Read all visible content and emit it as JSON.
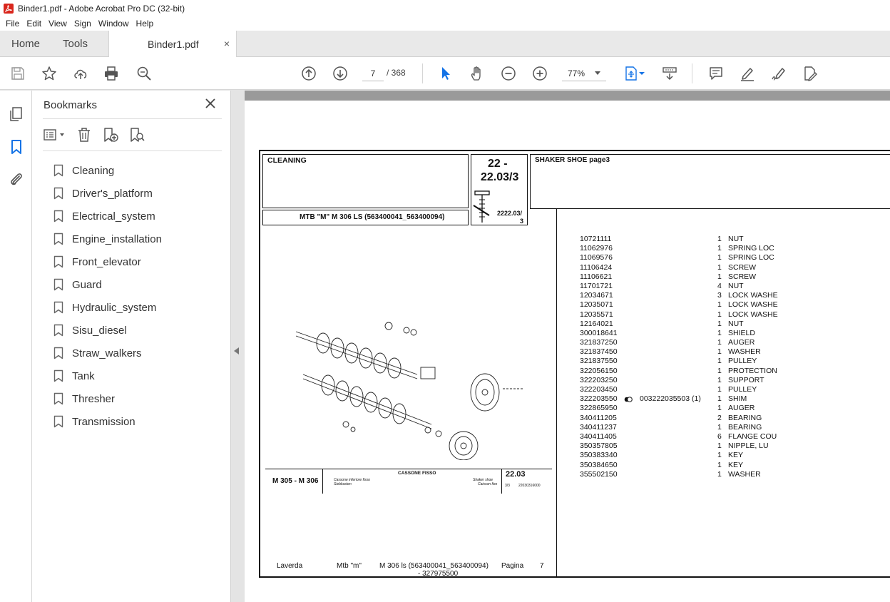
{
  "window": {
    "title": "Binder1.pdf - Adobe Acrobat Pro DC (32-bit)"
  },
  "menu": [
    "File",
    "Edit",
    "View",
    "Sign",
    "Window",
    "Help"
  ],
  "tabs": {
    "home": "Home",
    "tools": "Tools",
    "document": "Binder1.pdf",
    "close": "×"
  },
  "toolbar": {
    "current_page": "7",
    "page_total": "/ 368",
    "zoom": "77%"
  },
  "bookmarks": {
    "title": "Bookmarks",
    "items": [
      "Cleaning",
      "Driver's_platform",
      "Electrical_system",
      "Engine_installation",
      "Front_elevator",
      "Guard",
      "Hydraulic_system",
      "Sisu_diesel",
      "Straw_walkers",
      "Tank",
      "Thresher",
      "Transmission"
    ]
  },
  "pdf": {
    "section": "CLEANING",
    "code_line1": "22 -",
    "code_line2": "22.03/3",
    "group": "SHAKER SHOE  page3",
    "model": "MTB \"M\" M 306 LS (563400041_563400094)",
    "icon_label_1": "2222.03/",
    "icon_label_2": "3",
    "drawing": {
      "model_label": "M 305 - M 306",
      "title_it": "CASSONE FISSO",
      "subtitle_it": "Cassone inferiore fisso",
      "subtitle_de": "Siebkasten",
      "subtitle_en": "Shaker shoe",
      "subtitle_fr": "Caisson fixe",
      "table_no": "22.03",
      "sheet": "3/3",
      "doc_no": "22030316000"
    },
    "footer": {
      "brand": "Laverda",
      "series": "Mtb \"m\"",
      "model_line1": "M 306 ls (563400041_563400094)",
      "model_line2": "- 327975500",
      "page_label": "Pagina",
      "page_no": "7"
    },
    "parts": [
      {
        "code": "10721111",
        "qty": "1",
        "desc": "NUT"
      },
      {
        "code": "11062976",
        "qty": "1",
        "desc": "SPRING LOC"
      },
      {
        "code": "11069576",
        "qty": "1",
        "desc": "SPRING LOC"
      },
      {
        "code": "11106424",
        "qty": "1",
        "desc": "SCREW"
      },
      {
        "code": "11106621",
        "qty": "1",
        "desc": "SCREW"
      },
      {
        "code": "11701721",
        "qty": "4",
        "desc": "NUT"
      },
      {
        "code": "12034671",
        "qty": "3",
        "desc": "LOCK WASHE"
      },
      {
        "code": "12035071",
        "qty": "1",
        "desc": "LOCK WASHE"
      },
      {
        "code": "12035571",
        "qty": "1",
        "desc": "LOCK WASHE"
      },
      {
        "code": "12164021",
        "qty": "1",
        "desc": "NUT"
      },
      {
        "code": "300018641",
        "qty": "1",
        "desc": "SHIELD"
      },
      {
        "code": "321837250",
        "qty": "1",
        "desc": "AUGER"
      },
      {
        "code": "321837450",
        "qty": "1",
        "desc": "WASHER"
      },
      {
        "code": "321837550",
        "qty": "1",
        "desc": "PULLEY"
      },
      {
        "code": "322056150",
        "qty": "1",
        "desc": "PROTECTION"
      },
      {
        "code": "322203250",
        "qty": "1",
        "desc": "SUPPORT"
      },
      {
        "code": "322203450",
        "qty": "1",
        "desc": "PULLEY"
      },
      {
        "code": "322203550",
        "qty": "1",
        "desc": "SHIM",
        "extra": "003222035503  (1)"
      },
      {
        "code": "322865950",
        "qty": "1",
        "desc": "AUGER"
      },
      {
        "code": "340411205",
        "qty": "2",
        "desc": "BEARING"
      },
      {
        "code": "340411237",
        "qty": "1",
        "desc": "BEARING"
      },
      {
        "code": "340411405",
        "qty": "6",
        "desc": "FLANGE COU"
      },
      {
        "code": "350357805",
        "qty": "1",
        "desc": "NIPPLE, LU"
      },
      {
        "code": "350383340",
        "qty": "1",
        "desc": "KEY"
      },
      {
        "code": "350384650",
        "qty": "1",
        "desc": "KEY"
      },
      {
        "code": "355502150",
        "qty": "1",
        "desc": "WASHER"
      }
    ]
  }
}
